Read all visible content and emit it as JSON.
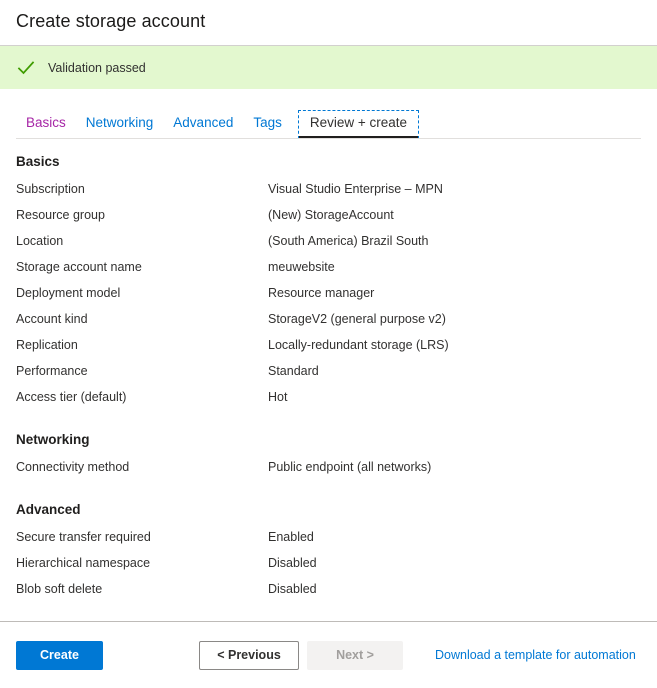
{
  "header": {
    "title": "Create storage account"
  },
  "validation": {
    "message": "Validation passed",
    "icon": "checkmark-icon",
    "background_color": "#e3f8cf",
    "check_color": "#3f9c00"
  },
  "tabs": [
    {
      "label": "Basics",
      "state": "visited",
      "color": "#a626a6"
    },
    {
      "label": "Networking",
      "state": "link",
      "color": "#0078d4"
    },
    {
      "label": "Advanced",
      "state": "link",
      "color": "#0078d4"
    },
    {
      "label": "Tags",
      "state": "link",
      "color": "#0078d4"
    },
    {
      "label": "Review + create",
      "state": "active",
      "color": "#323130"
    }
  ],
  "sections": [
    {
      "heading": "Basics",
      "rows": [
        {
          "label": "Subscription",
          "value": "Visual Studio Enterprise – MPN"
        },
        {
          "label": "Resource group",
          "value": "(New) StorageAccount"
        },
        {
          "label": "Location",
          "value": "(South America) Brazil South"
        },
        {
          "label": "Storage account name",
          "value": "meuwebsite"
        },
        {
          "label": "Deployment model",
          "value": "Resource manager"
        },
        {
          "label": "Account kind",
          "value": "StorageV2 (general purpose v2)"
        },
        {
          "label": "Replication",
          "value": "Locally-redundant storage (LRS)"
        },
        {
          "label": "Performance",
          "value": "Standard"
        },
        {
          "label": "Access tier (default)",
          "value": "Hot"
        }
      ]
    },
    {
      "heading": "Networking",
      "rows": [
        {
          "label": "Connectivity method",
          "value": "Public endpoint (all networks)"
        }
      ]
    },
    {
      "heading": "Advanced",
      "rows": [
        {
          "label": "Secure transfer required",
          "value": "Enabled"
        },
        {
          "label": "Hierarchical namespace",
          "value": "Disabled"
        },
        {
          "label": "Blob soft delete",
          "value": "Disabled"
        }
      ]
    }
  ],
  "footer": {
    "create_label": "Create",
    "previous_label": "< Previous",
    "next_label": "Next >",
    "download_label": "Download a template for automation",
    "accent_color": "#0078d4"
  }
}
